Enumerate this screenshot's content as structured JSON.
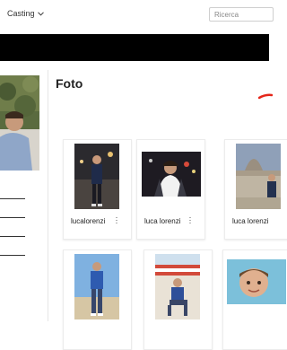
{
  "header": {
    "nav_dropdown": "Casting",
    "search_placeholder": "Ricerca"
  },
  "main": {
    "section_title": "Foto",
    "photos_row1": [
      {
        "name": "lucalorenzi"
      },
      {
        "name": "luca lorenzi"
      },
      {
        "name": "luca lorenzi"
      }
    ]
  },
  "icons": {
    "dropdown": "chevron-down-icon",
    "more": "kebab-menu-icon"
  },
  "colors": {
    "band": "#000000",
    "accent_mark": "#e5261a"
  }
}
